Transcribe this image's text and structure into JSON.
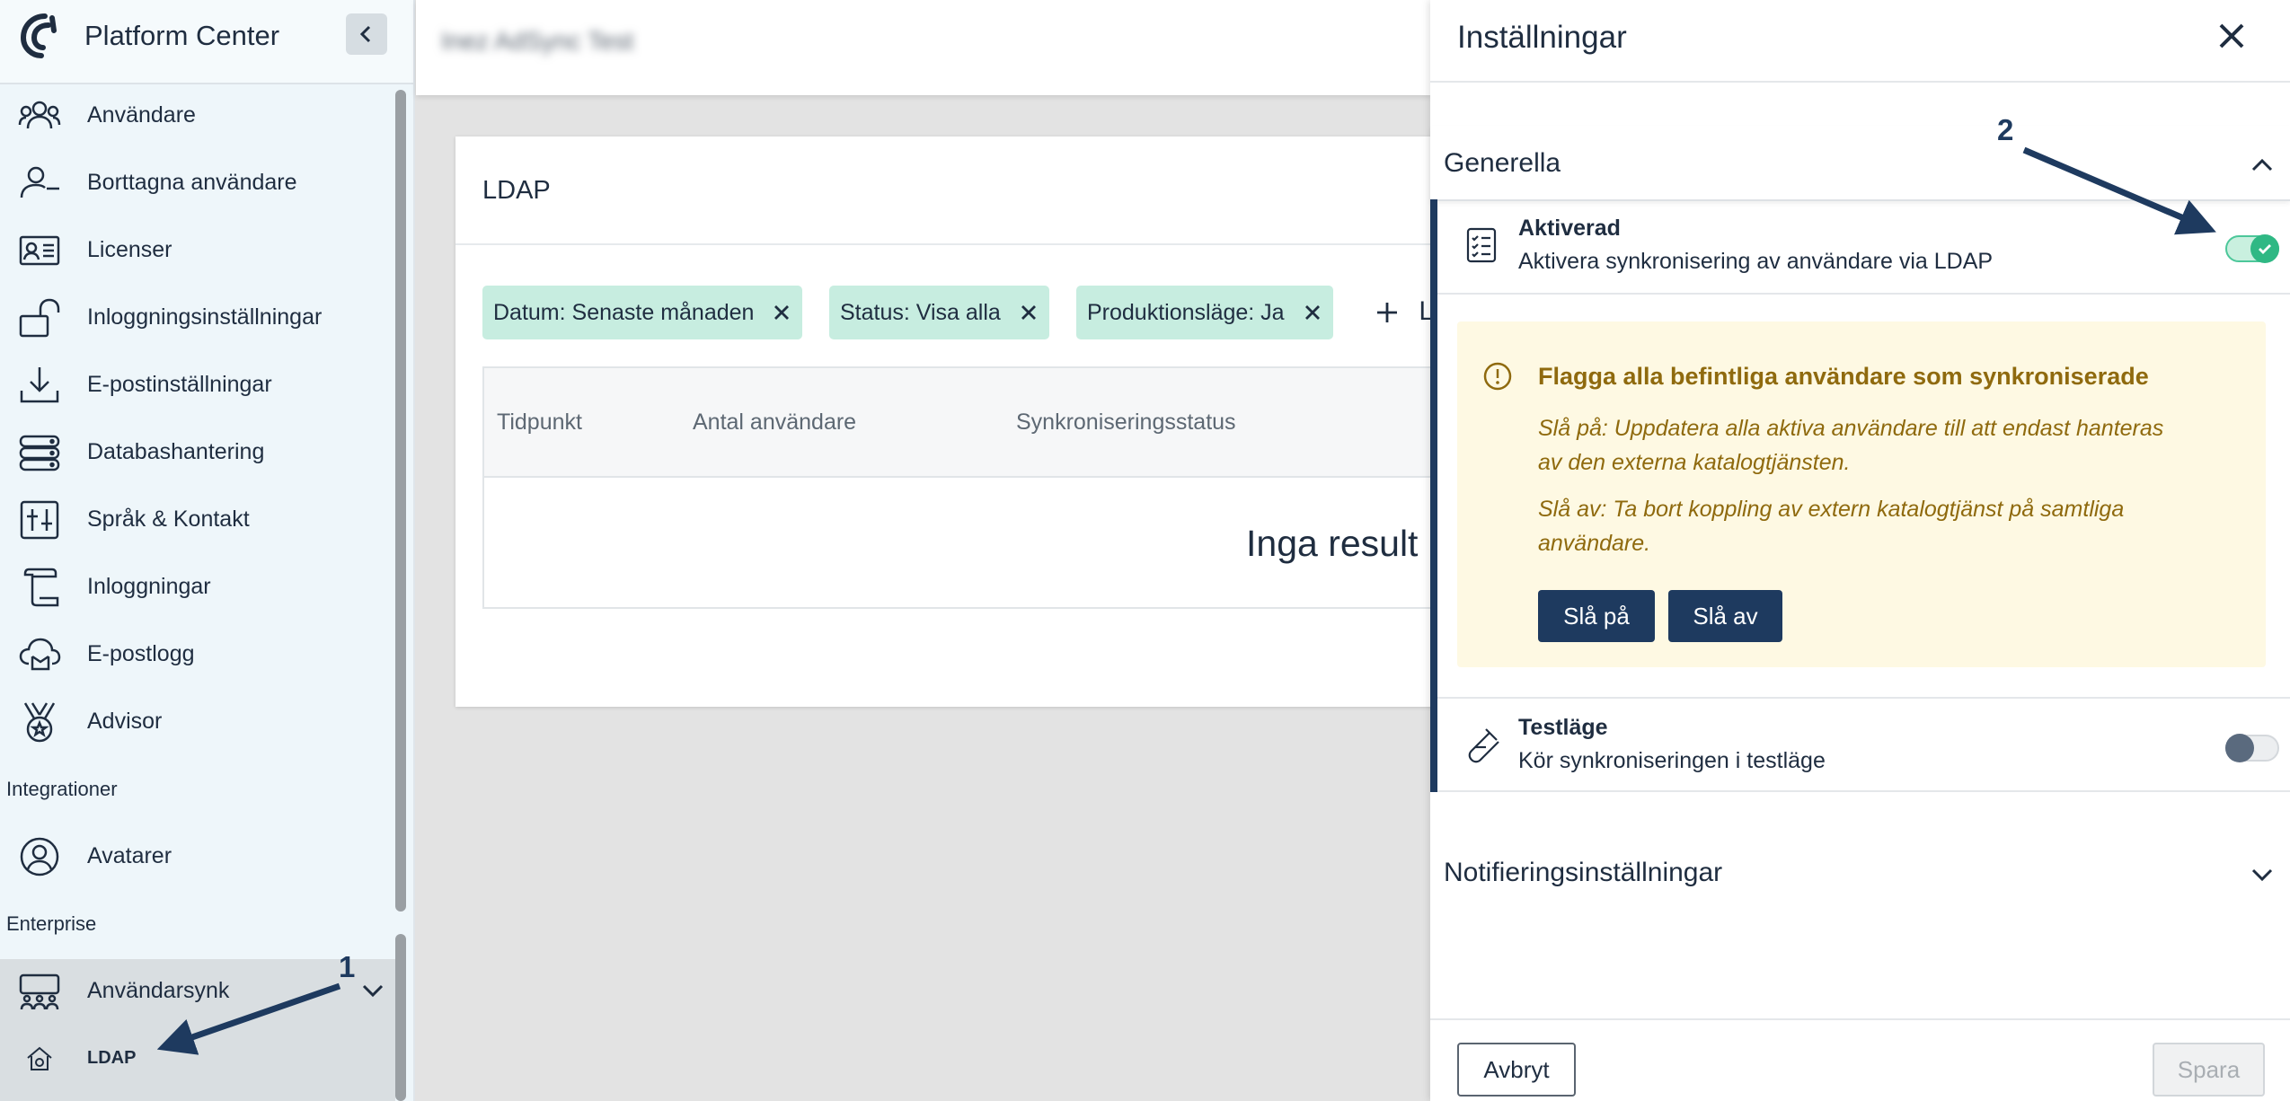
{
  "app": {
    "title": "Platform Center"
  },
  "sidebar": {
    "items": [
      {
        "label": "Användare",
        "icon": "users-icon"
      },
      {
        "label": "Borttagna användare",
        "icon": "user-minus-icon"
      },
      {
        "label": "Licenser",
        "icon": "id-card-icon"
      },
      {
        "label": "Inloggningsinställningar",
        "icon": "unlock-icon"
      },
      {
        "label": "E-postinställningar",
        "icon": "download-tray-icon"
      },
      {
        "label": "Databashantering",
        "icon": "server-icon"
      },
      {
        "label": "Språk & Kontakt",
        "icon": "sliders-icon"
      },
      {
        "label": "Inloggningar",
        "icon": "scroll-icon"
      },
      {
        "label": "E-postlogg",
        "icon": "cloud-mail-icon"
      },
      {
        "label": "Advisor",
        "icon": "medal-icon"
      }
    ],
    "sections": {
      "integrations": {
        "title": "Integrationer",
        "items": [
          {
            "label": "Avatarer",
            "icon": "user-circle-icon"
          }
        ]
      },
      "enterprise": {
        "title": "Enterprise",
        "group_label": "Användarsynk",
        "sub_item": "LDAP"
      }
    }
  },
  "main": {
    "header_title": "Inez AdSync Test",
    "card_title": "LDAP",
    "filters": [
      "Datum: Senaste månaden",
      "Status: Visa alla",
      "Produktionsläge: Ja"
    ],
    "add_filter_label": "L",
    "table": {
      "columns": [
        "Tidpunkt",
        "Antal användare",
        "Synkroniseringsstatus"
      ],
      "empty_text": "Inga result"
    }
  },
  "drawer": {
    "title": "Inställningar",
    "sections": {
      "general": "Generella",
      "notifications": "Notifieringsinställningar"
    },
    "activated": {
      "name": "Aktiverad",
      "description": "Aktivera synkronisering av användare via LDAP",
      "enabled": true
    },
    "warning": {
      "title": "Flagga alla befintliga användare som synkroniserade",
      "text_on_1": "Slå på: Uppdatera alla aktiva användare till att endast hanteras",
      "text_on_2": "av den externa katalogtjänsten.",
      "text_off_1": "Slå av: Ta bort koppling av extern katalogtjänst på samtliga",
      "text_off_2": "användare.",
      "button_on": "Slå på",
      "button_off": "Slå av"
    },
    "test_mode": {
      "name": "Testläge",
      "description": "Kör synkroniseringen i testläge",
      "enabled": false
    },
    "footer": {
      "cancel": "Avbryt",
      "save": "Spara"
    }
  },
  "annotations": {
    "marker_1": "1",
    "marker_2": "2"
  },
  "colors": {
    "accent": "#1e3a5f",
    "toggle_on": "#2fb884",
    "chip": "#c7ede0",
    "warning_bg": "#fef9e3",
    "warning_text": "#8f6a0e"
  }
}
